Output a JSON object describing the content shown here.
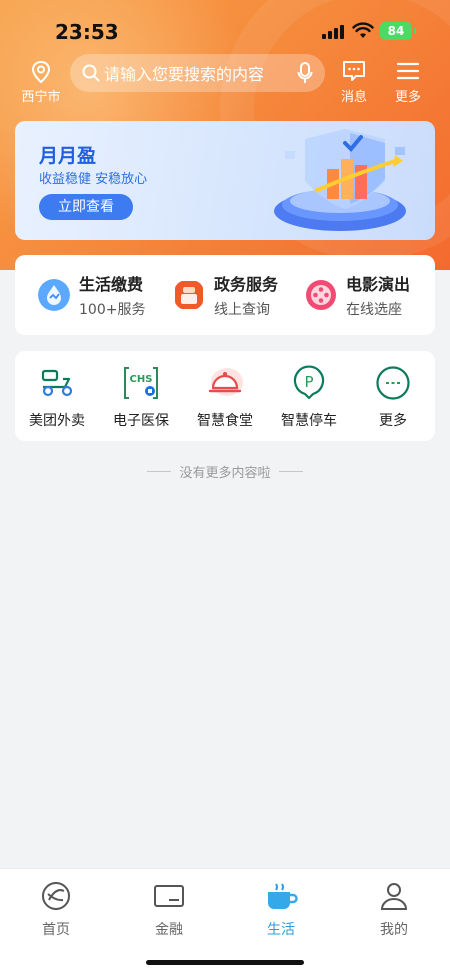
{
  "status": {
    "time": "23:53",
    "battery": "84"
  },
  "header": {
    "location_label": "西宁市",
    "search_placeholder": "请输入您要搜索的内容",
    "messages_label": "消息",
    "more_label": "更多"
  },
  "banner": {
    "title": "月月盈",
    "subtitle": "收益稳健 安稳放心",
    "button_label": "立即查看"
  },
  "services": [
    {
      "title": "生活缴费",
      "subtitle": "100+服务",
      "icon": "droplet-icon"
    },
    {
      "title": "政务服务",
      "subtitle": "线上查询",
      "icon": "government-icon"
    },
    {
      "title": "电影演出",
      "subtitle": "在线选座",
      "icon": "film-reel-icon"
    }
  ],
  "quick": [
    {
      "label": "美团外卖",
      "icon": "scooter-icon"
    },
    {
      "label": "电子医保",
      "icon": "chs-card-icon",
      "icon_text": "CHS"
    },
    {
      "label": "智慧食堂",
      "icon": "food-cloche-icon"
    },
    {
      "label": "智慧停车",
      "icon": "parking-icon",
      "icon_text": "P"
    },
    {
      "label": "更多",
      "icon": "more-dots-icon"
    }
  ],
  "no_more_text": "没有更多内容啦",
  "tabbar": {
    "tabs": [
      {
        "label": "首页",
        "icon": "home-icon"
      },
      {
        "label": "金融",
        "icon": "card-icon"
      },
      {
        "label": "生活",
        "icon": "cup-icon",
        "active": true
      },
      {
        "label": "我的",
        "icon": "user-icon"
      }
    ]
  },
  "colors": {
    "accent_orange": "#f58a3c",
    "active_tab": "#2a9de0",
    "banner_blue": "#3d7bf0"
  }
}
